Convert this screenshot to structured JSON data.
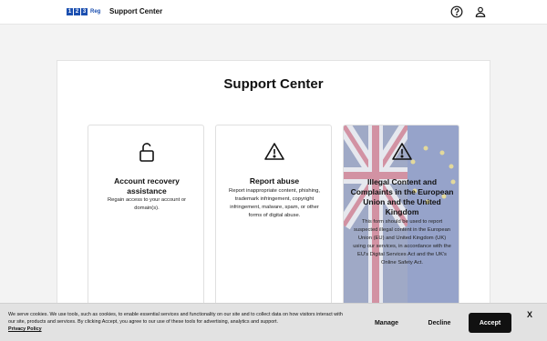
{
  "header": {
    "logo_digits": [
      "1",
      "2",
      "3"
    ],
    "logo_suffix": "Reg",
    "title": "Support Center",
    "icons": [
      "help-icon",
      "user-icon"
    ]
  },
  "main": {
    "title": "Support Center",
    "cards": [
      {
        "icon": "unlock-icon",
        "title": "Account recovery assistance",
        "description": "Regain access to your account or domain(s)."
      },
      {
        "icon": "warning-icon",
        "title": "Report abuse",
        "description": "Report inappropriate content, phishing, trademark infringement, copyright infringement, malware, spam, or other forms of digital abuse."
      },
      {
        "icon": "warning-icon",
        "title": "Illegal Content and Complaints in the European Union and the United Kingdom",
        "description": "This form should be used to report suspected illegal content in the European Union (EU) and United Kingdom (UK) using our services, in accordance with the EU's Digital Services Act and the UK's Online Safety Act.",
        "background": "eu-uk-flag"
      }
    ]
  },
  "cookie_banner": {
    "text": "We serve cookies. We use tools, such as cookies, to enable essential services and functionality on our site and to collect data on how visitors interact with our site, products and services. By clicking Accept, you agree to our use of these tools for advertising, analytics and support.",
    "link": "Privacy Policy",
    "manage_label": "Manage",
    "decline_label": "Decline",
    "accept_label": "Accept",
    "close_label": "X"
  },
  "colors": {
    "brand": "#1b4fb0",
    "accept_button": "#111111",
    "cookie_bg": "#e2e2e2"
  }
}
